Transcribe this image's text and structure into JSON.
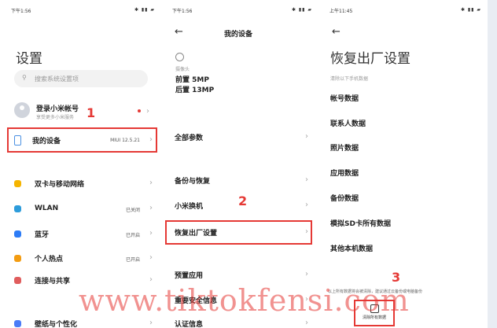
{
  "panel1": {
    "status": {
      "time": "下午1:56",
      "icons": "✱ ▮▮ ▰"
    },
    "title": "设置",
    "search": {
      "placeholder": "搜索系统设置项"
    },
    "account": {
      "title": "登录小米帐号",
      "subtitle": "享受更多小米服务"
    },
    "my_device": {
      "label": "我的设备",
      "value": "MIUI 12.5.21"
    },
    "items": [
      {
        "label": "双卡与移动网络",
        "value": "",
        "icon": "sim-icon",
        "color": "#f5b400"
      },
      {
        "label": "WLAN",
        "value": "已关闭",
        "icon": "wifi-icon",
        "color": "#2d9cdb"
      },
      {
        "label": "蓝牙",
        "value": "已开启",
        "icon": "bluetooth-icon",
        "color": "#2d7cf6"
      },
      {
        "label": "个人热点",
        "value": "已开启",
        "icon": "hotspot-icon",
        "color": "#f39c12"
      },
      {
        "label": "连接与共享",
        "value": "",
        "icon": "share-icon",
        "color": "#e05d5d"
      },
      {
        "label": "壁纸与个性化",
        "value": "",
        "icon": "wallpaper-icon",
        "color": "#4a7cf7"
      }
    ],
    "marker": "1"
  },
  "panel2": {
    "status": {
      "time": "下午1:56",
      "icons": "✱ ▮▮ ▰"
    },
    "back": "←",
    "title": "我的设备",
    "camera": {
      "label": "摄像头",
      "front": "前置 5MP",
      "rear": "后置 13MP"
    },
    "items": [
      {
        "label": "全部参数"
      },
      {
        "label": "备份与恢复"
      },
      {
        "label": "小米换机"
      },
      {
        "label": "恢复出厂设置"
      },
      {
        "label": "预置应用"
      },
      {
        "label": "重要安全信息"
      },
      {
        "label": "认证信息"
      }
    ],
    "marker": "2"
  },
  "panel3": {
    "status": {
      "time": "上午11:45",
      "icons": "✱ ▮▮ ▰"
    },
    "back": "←",
    "title": "恢复出厂设置",
    "subtitle": "清除以下手机数据",
    "items": [
      "帐号数据",
      "联系人数据",
      "照片数据",
      "应用数据",
      "备份数据",
      "模拟SD卡所有数据",
      "其他本机数据"
    ],
    "notice": "以上所有数据将会被清除，建议通过云备份或电脑备份",
    "clear_button": "清除所有数据",
    "marker": "3"
  },
  "watermark": "www.tiktokfensi.com"
}
